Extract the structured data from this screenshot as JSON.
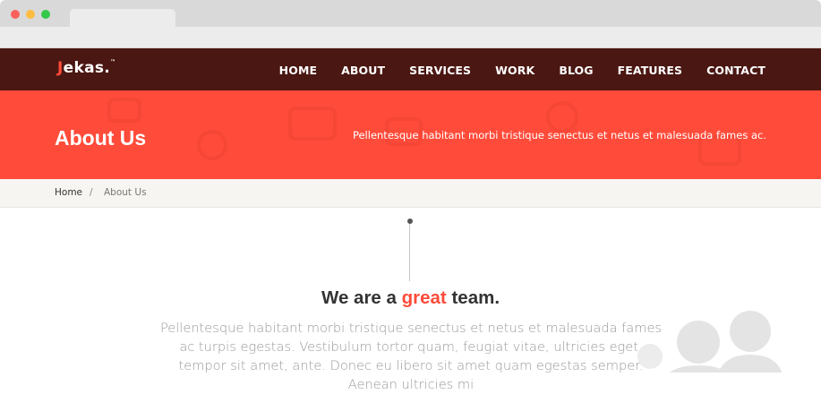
{
  "brand": {
    "logo_first": "J",
    "logo_rest": "ekas.",
    "logo_tm": "™"
  },
  "nav": [
    {
      "label": "HOME"
    },
    {
      "label": "ABOUT"
    },
    {
      "label": "SERVICES"
    },
    {
      "label": "WORK"
    },
    {
      "label": "BLOG"
    },
    {
      "label": "FEATURES"
    },
    {
      "label": "CONTACT"
    }
  ],
  "hero": {
    "title": "About Us",
    "subtitle": "Pellentesque habitant morbi tristique senectus et netus et malesuada fames ac."
  },
  "breadcrumb": {
    "home": "Home",
    "separator": "/",
    "current": "About Us"
  },
  "section": {
    "heading_before": "We are a ",
    "heading_highlight": "great",
    "heading_after": " team.",
    "paragraph": "Pellentesque habitant morbi tristique senectus et netus et malesuada fames ac turpis egestas. Vestibulum tortor quam, feugiat vitae, ultricies eget, tempor sit amet, ante. Donec eu libero sit amet quam egestas semper. Aenean ultricies mi"
  },
  "colors": {
    "accent": "#ff4b3a",
    "navbar": "#4a1712",
    "breadcrumb_bg": "#f7f5f2"
  },
  "icons": [
    "team-icon"
  ]
}
